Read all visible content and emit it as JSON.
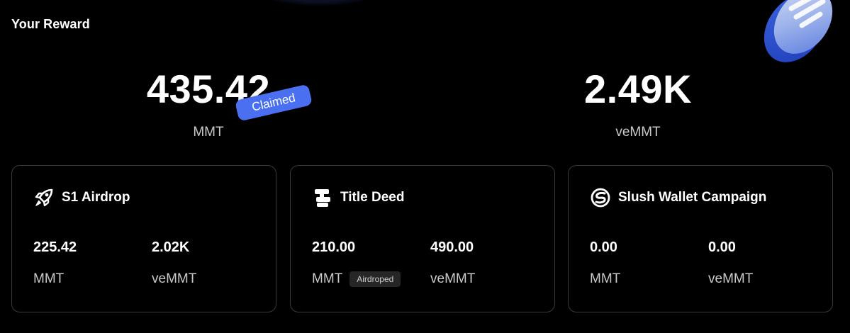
{
  "header": {
    "title": "Your Reward"
  },
  "totals": {
    "mmt": {
      "value": "435.42",
      "unit": "MMT",
      "badge": "Claimed"
    },
    "vemmt": {
      "value": "2.49K",
      "unit": "veMMT"
    }
  },
  "cards": [
    {
      "title": "S1 Airdrop",
      "icon": "rocket-icon",
      "mmt_value": "225.42",
      "mmt_unit": "MMT",
      "vemmt_value": "2.02K",
      "vemmt_unit": "veMMT"
    },
    {
      "title": "Title Deed",
      "icon": "signpost-icon",
      "mmt_value": "210.00",
      "mmt_unit": "MMT",
      "mmt_tag": "Airdroped",
      "vemmt_value": "490.00",
      "vemmt_unit": "veMMT"
    },
    {
      "title": "Slush Wallet Campaign",
      "icon": "slush-logo-icon",
      "mmt_value": "0.00",
      "mmt_unit": "MMT",
      "vemmt_value": "0.00",
      "vemmt_unit": "veMMT"
    }
  ],
  "colors": {
    "background": "#000000",
    "accent": "#4a6ff0",
    "card_border": "#3a3a3a",
    "muted_text": "#c9c9c9"
  }
}
